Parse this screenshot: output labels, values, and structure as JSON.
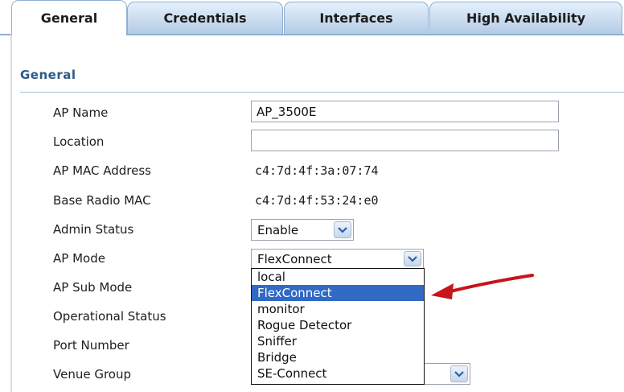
{
  "tabs": [
    {
      "label": "General",
      "active": true
    },
    {
      "label": "Credentials",
      "active": false
    },
    {
      "label": "Interfaces",
      "active": false
    },
    {
      "label": "High Availability",
      "active": false
    }
  ],
  "section": {
    "title": "General"
  },
  "fields": {
    "ap_name": {
      "label": "AP Name",
      "value": "AP_3500E"
    },
    "location": {
      "label": "Location",
      "value": ""
    },
    "ap_mac": {
      "label": "AP MAC Address",
      "value": "c4:7d:4f:3a:07:74"
    },
    "base_radio_mac": {
      "label": "Base Radio MAC",
      "value": "c4:7d:4f:53:24:e0"
    },
    "admin_status": {
      "label": "Admin Status",
      "value": "Enable"
    },
    "ap_mode": {
      "label": "AP Mode",
      "value": "FlexConnect"
    },
    "ap_sub_mode": {
      "label": "AP Sub Mode"
    },
    "operational_status": {
      "label": "Operational Status"
    },
    "port_number": {
      "label": "Port Number"
    },
    "venue_group": {
      "label": "Venue Group"
    }
  },
  "ap_mode_options": [
    "local",
    "FlexConnect",
    "monitor",
    "Rogue Detector",
    "Sniffer",
    "Bridge",
    "SE-Connect"
  ],
  "ap_mode_selected_index": 1,
  "colors": {
    "selection": "#316ac5",
    "annotation_arrow": "#c8141b",
    "section_title": "#2b5b86",
    "tab_border": "#8fb0d3"
  },
  "icons": {
    "dropdown": "chevron-down-icon",
    "annotation": "red-arrow-icon"
  }
}
